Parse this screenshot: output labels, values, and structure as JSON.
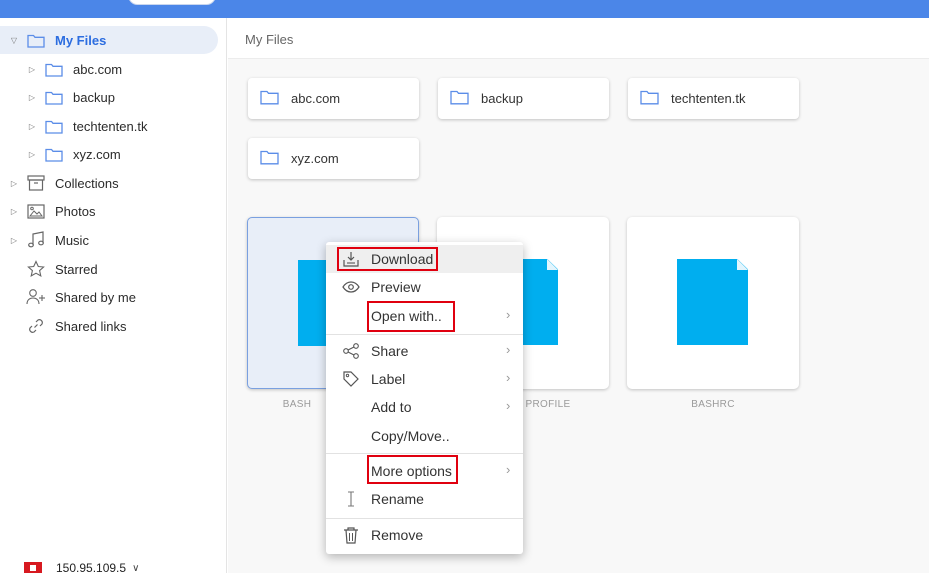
{
  "sidebar": {
    "my_files": "My Files",
    "folders": [
      "abc.com",
      "backup",
      "techtenten.tk",
      "xyz.com"
    ],
    "collections": "Collections",
    "photos": "Photos",
    "music": "Music",
    "starred": "Starred",
    "shared_by_me": "Shared by me",
    "shared_links": "Shared links",
    "ip": "150.95.109.5"
  },
  "breadcrumb": "My Files",
  "folder_cards": [
    "abc.com",
    "backup",
    "techtenten.tk",
    "xyz.com"
  ],
  "files": {
    "first": "BASH",
    "second": "PROFILE",
    "third": "BASHRC"
  },
  "context_menu": {
    "download": "Download",
    "preview": "Preview",
    "open_with": "Open with..",
    "share": "Share",
    "label": "Label",
    "add_to": "Add to",
    "copy_move": "Copy/Move..",
    "more_options": "More options",
    "rename": "Rename",
    "remove": "Remove"
  },
  "colors": {
    "topbar": "#4b86e8",
    "accent": "#2c6de0",
    "file_icon": "#00aeef",
    "highlight": "#e0000f"
  }
}
